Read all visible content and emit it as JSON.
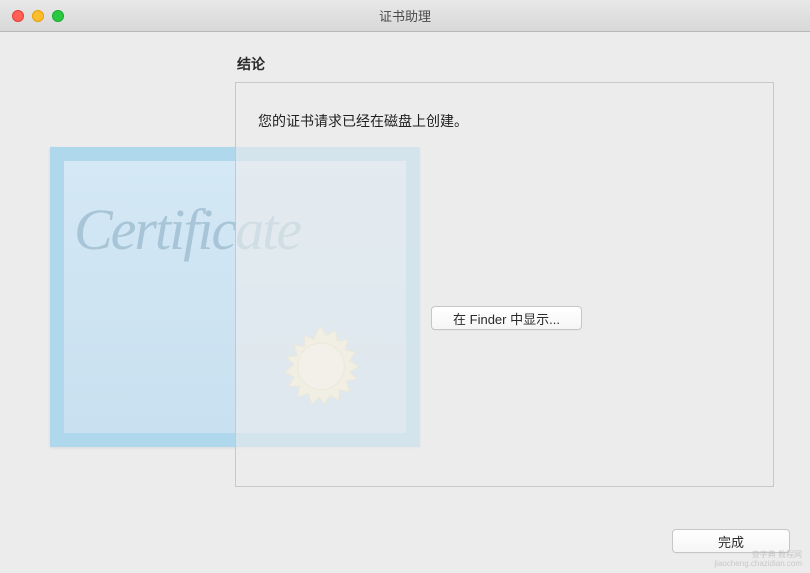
{
  "window": {
    "title": "证书助理"
  },
  "panel": {
    "heading": "结论",
    "body": "您的证书请求已经在磁盘上创建。"
  },
  "buttons": {
    "finder": "在 Finder 中显示...",
    "done": "完成"
  },
  "decoration": {
    "certificate_word": "Certificate"
  },
  "watermark": {
    "line1": "查字典 教程网",
    "line2": "jiaocheng.chazidian.com"
  }
}
